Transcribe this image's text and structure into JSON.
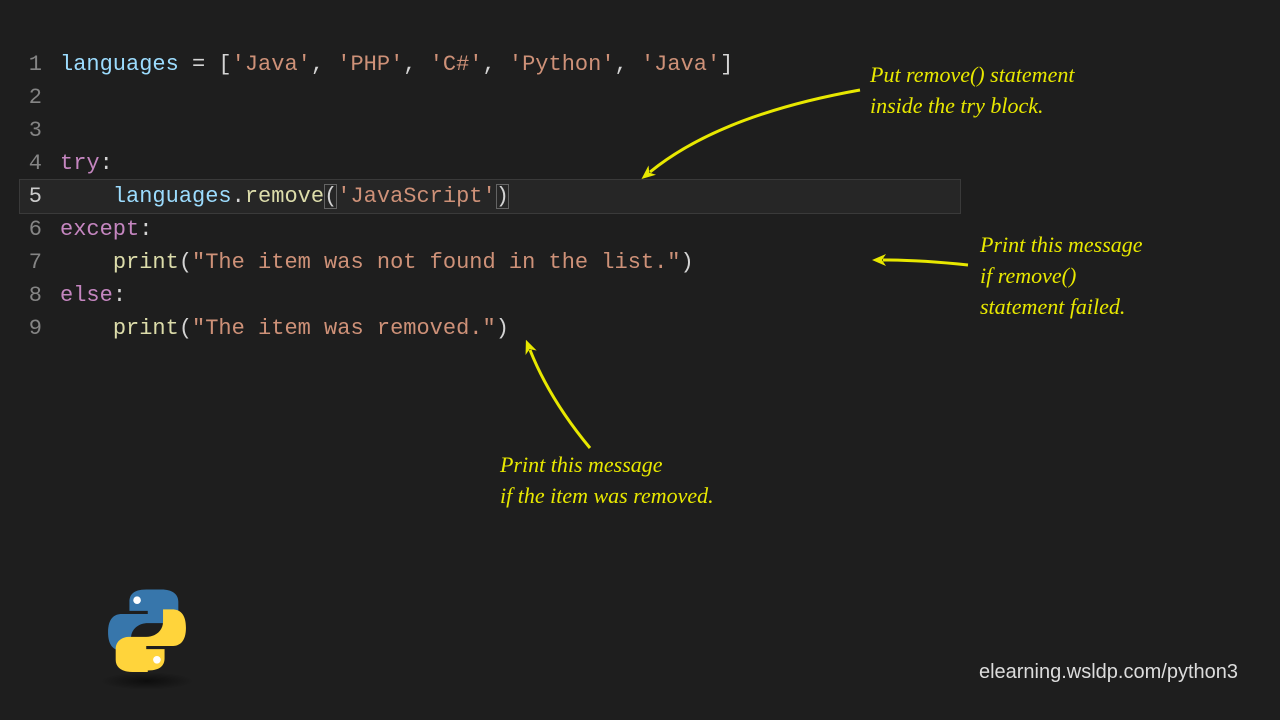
{
  "code": {
    "lines": [
      {
        "n": "1",
        "tokens": [
          {
            "t": "languages",
            "c": "tok-var"
          },
          {
            "t": " = [",
            "c": "tok-punc"
          },
          {
            "t": "'Java'",
            "c": "tok-str"
          },
          {
            "t": ", ",
            "c": "tok-punc"
          },
          {
            "t": "'PHP'",
            "c": "tok-str"
          },
          {
            "t": ", ",
            "c": "tok-punc"
          },
          {
            "t": "'C#'",
            "c": "tok-str"
          },
          {
            "t": ", ",
            "c": "tok-punc"
          },
          {
            "t": "'Python'",
            "c": "tok-str"
          },
          {
            "t": ", ",
            "c": "tok-punc"
          },
          {
            "t": "'Java'",
            "c": "tok-str"
          },
          {
            "t": "]",
            "c": "tok-punc"
          }
        ]
      },
      {
        "n": "2",
        "tokens": []
      },
      {
        "n": "3",
        "tokens": []
      },
      {
        "n": "4",
        "tokens": [
          {
            "t": "try",
            "c": "tok-kw"
          },
          {
            "t": ":",
            "c": "tok-punc"
          }
        ]
      },
      {
        "n": "5",
        "current": true,
        "tokens": [
          {
            "t": "    ",
            "c": ""
          },
          {
            "t": "languages",
            "c": "tok-var"
          },
          {
            "t": ".",
            "c": "tok-punc"
          },
          {
            "t": "remove",
            "c": "tok-func"
          },
          {
            "t": "(",
            "c": "tok-paren bracket-hl"
          },
          {
            "t": "'JavaScript'",
            "c": "tok-str"
          },
          {
            "t": ")",
            "c": "tok-paren bracket-hl"
          }
        ]
      },
      {
        "n": "6",
        "tokens": [
          {
            "t": "except",
            "c": "tok-kw"
          },
          {
            "t": ":",
            "c": "tok-punc"
          }
        ]
      },
      {
        "n": "7",
        "tokens": [
          {
            "t": "    ",
            "c": ""
          },
          {
            "t": "print",
            "c": "tok-func"
          },
          {
            "t": "(",
            "c": "tok-paren"
          },
          {
            "t": "\"The item was not found in the list.\"",
            "c": "tok-str"
          },
          {
            "t": ")",
            "c": "tok-paren"
          }
        ]
      },
      {
        "n": "8",
        "tokens": [
          {
            "t": "else",
            "c": "tok-kw"
          },
          {
            "t": ":",
            "c": "tok-punc"
          }
        ]
      },
      {
        "n": "9",
        "tokens": [
          {
            "t": "    ",
            "c": ""
          },
          {
            "t": "print",
            "c": "tok-func"
          },
          {
            "t": "(",
            "c": "tok-paren"
          },
          {
            "t": "\"The item was removed.\"",
            "c": "tok-str"
          },
          {
            "t": ")",
            "c": "tok-paren"
          }
        ]
      }
    ]
  },
  "annotations": {
    "a1": "Put remove() statement\ninside the try block.",
    "a2": "Print this message\nif remove()\nstatement failed.",
    "a3": "Print this message\nif the item was removed."
  },
  "footer": "elearning.wsldp.com/python3",
  "colors": {
    "arrow": "#e8e800"
  }
}
